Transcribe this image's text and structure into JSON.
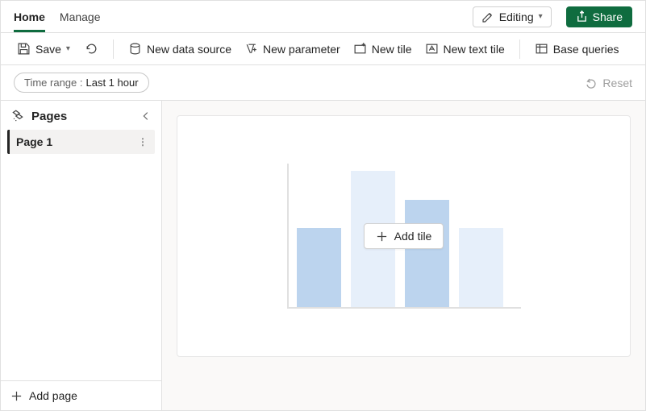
{
  "tabs": {
    "home": "Home",
    "manage": "Manage"
  },
  "header": {
    "editing_label": "Editing",
    "share_label": "Share"
  },
  "toolbar": {
    "save_label": "Save",
    "new_data_source": "New data source",
    "new_parameter": "New parameter",
    "new_tile": "New tile",
    "new_text_tile": "New text tile",
    "base_queries": "Base queries"
  },
  "filter": {
    "time_range_label": "Time range :",
    "time_range_value": "Last 1 hour",
    "reset_label": "Reset"
  },
  "sidebar": {
    "title": "Pages",
    "items": [
      {
        "label": "Page 1"
      }
    ],
    "add_page_label": "Add page"
  },
  "canvas": {
    "add_tile_label": "Add tile"
  }
}
